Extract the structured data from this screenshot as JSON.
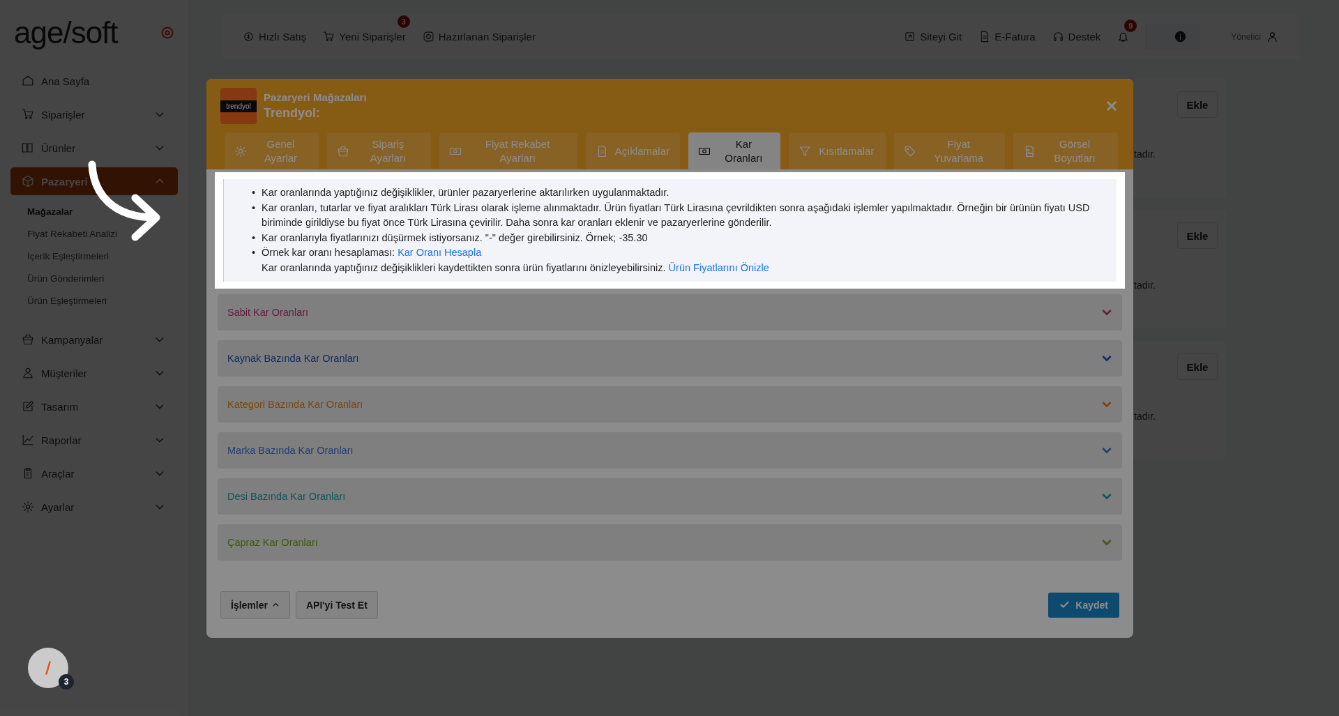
{
  "logo": {
    "text": "age/soft"
  },
  "sidebar": {
    "items": [
      {
        "label": "Ana Sayfa",
        "selected": false
      },
      {
        "label": "Siparişler",
        "expanded": false,
        "selected": false
      },
      {
        "label": "Ürünler",
        "expanded": false,
        "selected": false
      },
      {
        "label": "Pazaryeri",
        "expanded": true,
        "selected": true,
        "children": [
          {
            "label": "Mağazalar",
            "selected": true
          },
          {
            "label": "Fiyat Rekabeti Analizi",
            "selected": false
          },
          {
            "label": "İçerik Eşleştirmeleri",
            "selected": false
          },
          {
            "label": "Ürün Gönderimleri",
            "selected": false
          },
          {
            "label": "Ürün Eşleştirmeleri",
            "selected": false
          }
        ]
      },
      {
        "label": "Kampanyalar",
        "expanded": false,
        "selected": false
      },
      {
        "label": "Müşteriler",
        "expanded": false,
        "selected": false
      },
      {
        "label": "Tasarım",
        "expanded": false,
        "selected": false
      },
      {
        "label": "Raporlar",
        "expanded": false,
        "selected": false
      },
      {
        "label": "Araçlar",
        "expanded": false,
        "selected": false
      },
      {
        "label": "Ayarlar",
        "expanded": false,
        "selected": false
      }
    ]
  },
  "helper_widget": {
    "badge": "3"
  },
  "topbar": {
    "left": [
      {
        "label": "Hızlı Satış"
      },
      {
        "label": "Yeni Siparişler",
        "badge": "3"
      },
      {
        "label": "Hazırlanan Siparişler"
      }
    ],
    "right": [
      {
        "label": "Siteyi Git"
      },
      {
        "label": "E-Fatura"
      },
      {
        "label": "Destek"
      }
    ],
    "notifications_badge": "9",
    "user": "Yönetici"
  },
  "background_cards": [
    {
      "text": "tadır.",
      "button": "Ekle"
    },
    {
      "text": "tadır.",
      "button": "Ekle"
    },
    {
      "text": "tadır.",
      "button": "Ekle"
    }
  ],
  "modal": {
    "logo": "trendyol",
    "title": "Pazaryeri Mağazaları",
    "subtitle": "Trendyol:",
    "tabs": [
      {
        "label": "Genel Ayarlar",
        "selected": false
      },
      {
        "label": "Sipariş Ayarları",
        "selected": false
      },
      {
        "label": "Fiyat Rekabet Ayarları",
        "selected": false
      },
      {
        "label": "Açıklamalar",
        "selected": false
      },
      {
        "label": "Kar Oranları",
        "selected": true
      },
      {
        "label": "Kısıtlamalar",
        "selected": false
      },
      {
        "label": "Fiyat Yuvarlama",
        "selected": false
      },
      {
        "label": "Görsel Boyutları",
        "selected": false
      }
    ],
    "notes": [
      {
        "bullet": "•",
        "lines": [
          {
            "text": "Kar oranlarında yaptığınız değişiklikler, ürünler pazaryerlerine aktarılırken uygulanmaktadır."
          }
        ]
      },
      {
        "bullet": "•",
        "lines": [
          {
            "text": "Kar oranları, tutarlar ve fiyat aralıkları Türk Lirası olarak işleme alınmaktadır. Ürün fiyatları Türk Lirasına çevrildikten sonra aşağıdaki işlemler yapılmaktadır. Örneğin bir ürünün fiyatı USD biriminde girildiyse bu fiyat önce Türk Lirasına çevirilir. Daha sonra kar oranları eklenir ve pazaryerlerine gönderilir."
          }
        ]
      },
      {
        "bullet": "•",
        "lines": [
          {
            "text": "Kar oranlarıyla fiyatlarınızı düşürmek istiyorsanız. \"-\" değer girebilirsiniz. Örnek; -35.30"
          }
        ]
      },
      {
        "bullet": "•",
        "lines": [
          {
            "text": "Örnek kar oranı hesaplaması:",
            "link": "Kar Oranı Hesapla"
          },
          {
            "text": "Kar oranlarında yaptığınız değişiklikleri kaydettikten sonra ürün fiyatlarını önizleyebilirsiniz.",
            "link": "Ürün Fiyatlarını Önizle"
          }
        ]
      }
    ],
    "sections": [
      {
        "title": "Sabit Kar Oranları",
        "color": "#641c3d",
        "expanded": false
      },
      {
        "title": "Kaynak Bazında Kar Oranları",
        "color": "#122c61",
        "expanded": false
      },
      {
        "title": "Kategori Bazında Kar Oranları",
        "color": "#79460f",
        "expanded": false
      },
      {
        "title": "Marka Bazında Kar Oranları",
        "color": "#213f72",
        "expanded": false
      },
      {
        "title": "Desi Bazında Kar Oranları",
        "color": "#0e575b",
        "expanded": false
      },
      {
        "title": "Çapraz Kar Oranları",
        "color": "#3d580f",
        "expanded": false
      }
    ],
    "footer": {
      "actions": "İşlemler",
      "test": "API'yi Test Et",
      "save": "Kaydet"
    }
  }
}
